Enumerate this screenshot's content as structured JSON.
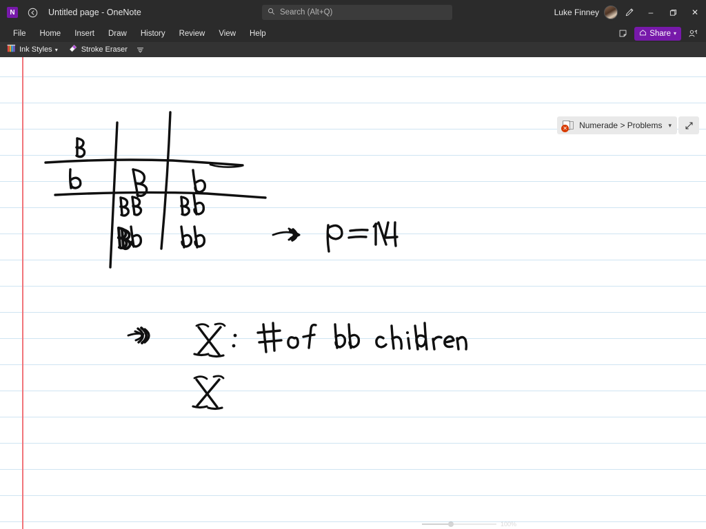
{
  "window": {
    "app_logo_glyph": "N",
    "title": "Untitled page  -  OneNote",
    "back_icon": "back-arrow-icon",
    "minimize_glyph": "–",
    "restore_glyph": "❐",
    "close_glyph": "✕"
  },
  "search": {
    "placeholder": "Search (Alt+Q)",
    "icon": "search-icon"
  },
  "account": {
    "user_name": "Luke Finney",
    "avatar_name": "user-avatar",
    "pen_icon": "pen-icon"
  },
  "menu": {
    "items": [
      {
        "label": "File"
      },
      {
        "label": "Home"
      },
      {
        "label": "Insert"
      },
      {
        "label": "Draw"
      },
      {
        "label": "History"
      },
      {
        "label": "Review"
      },
      {
        "label": "View"
      },
      {
        "label": "Help"
      }
    ],
    "sticky_note_icon": "sticky-note-icon",
    "share_label": "Share",
    "share_icon": "share-icon",
    "share_caret": "▾",
    "people_icon": "people-icon",
    "share_color": "#7719aa"
  },
  "ribbon": {
    "items": [
      {
        "label": "Ink Styles",
        "icon": "ink-styles-icon",
        "caret": "▾"
      },
      {
        "label": "Stroke Eraser",
        "icon": "eraser-icon",
        "caret": ""
      }
    ],
    "overflow_glyph": "☰"
  },
  "notebook_bar": {
    "label": "Numerade > Problems",
    "caret": "▾",
    "notebook_icon": "notebook-icon",
    "sync_error_icon": "sync-error-icon",
    "sync_error_glyph": "✕",
    "expand_icon": "expand-icon",
    "error_color": "#d83b01"
  },
  "page": {
    "rule_line_color": "#cfe4f2",
    "margin_line_color": "#f1747a",
    "background": "#ffffff",
    "ink_color": "#101010",
    "handwriting": {
      "punnett_square": {
        "row_header_top": "B",
        "row_header_bottom": "b",
        "col_header_left": "B",
        "col_header_right": "b",
        "cells": [
          [
            "BB",
            "Bb"
          ],
          [
            "Bb",
            "bb"
          ]
        ]
      },
      "annotations": [
        {
          "text": "p = 1/4",
          "pointer": "arrow-scribble"
        },
        {
          "text": "X : # of bb children",
          "pointer": "arrow-scribble"
        },
        {
          "text": "X",
          "pointer": ""
        }
      ]
    }
  },
  "status": {
    "zoom_percent": "100%"
  }
}
